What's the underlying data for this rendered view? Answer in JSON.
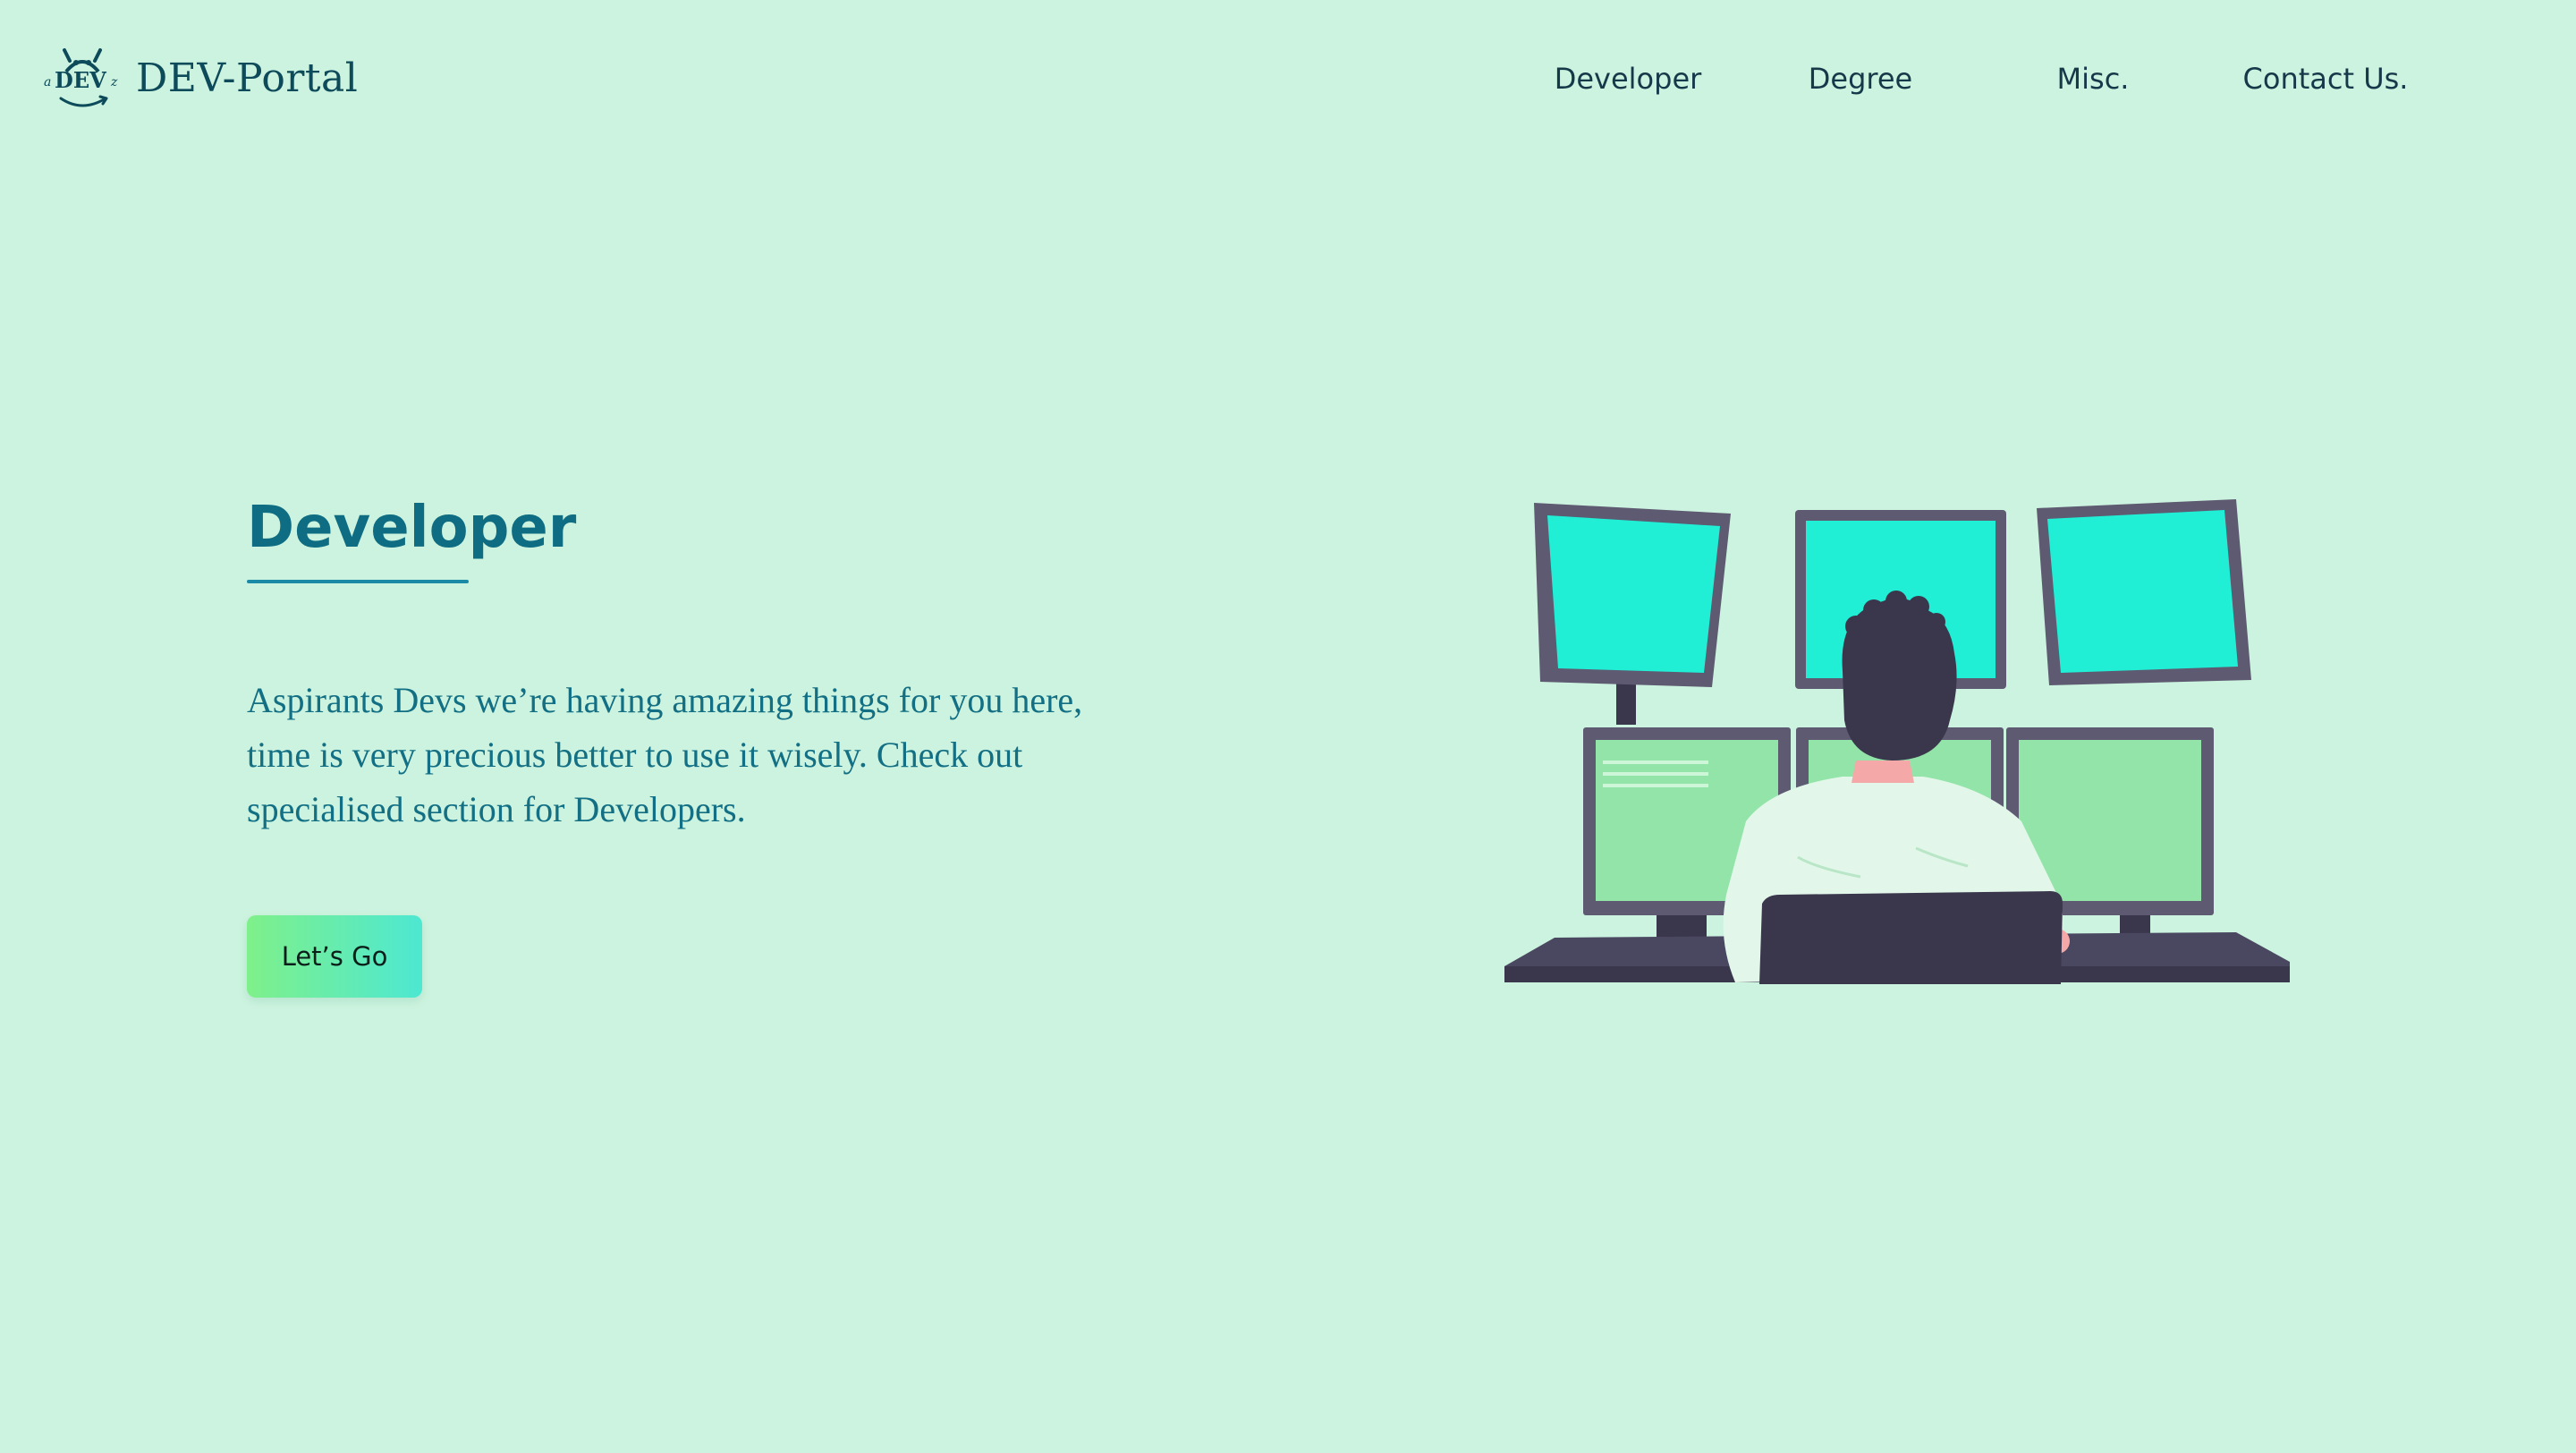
{
  "header": {
    "logo": {
      "icon": "dev-mascot-logo-icon",
      "text_left": "a",
      "text_main": "DEV",
      "text_right": "z"
    },
    "brand_name": "DEV-Portal",
    "nav": [
      {
        "label": "Developer"
      },
      {
        "label": "Degree"
      },
      {
        "label": "Misc."
      },
      {
        "label": "Contact Us."
      }
    ]
  },
  "hero": {
    "title": "Developer",
    "description": "Aspirants Devs we’re having amazing things for you here, time is very precious better to use it wisely. Check out specialised section for Developers.",
    "cta_label": "Let’s Go"
  },
  "illustration": {
    "icon": "developer-at-multi-monitor-desk-illustration"
  },
  "colors": {
    "background": "#ccf3df",
    "brand_text": "#0d4a5a",
    "heading": "#0e6d82",
    "body_text": "#126f84",
    "button_gradient_start": "#7ff08a",
    "button_gradient_end": "#4de8d2",
    "monitor_frame": "#5e5a72",
    "screen_cyan": "#20efd6",
    "screen_green": "#93e4a8"
  }
}
